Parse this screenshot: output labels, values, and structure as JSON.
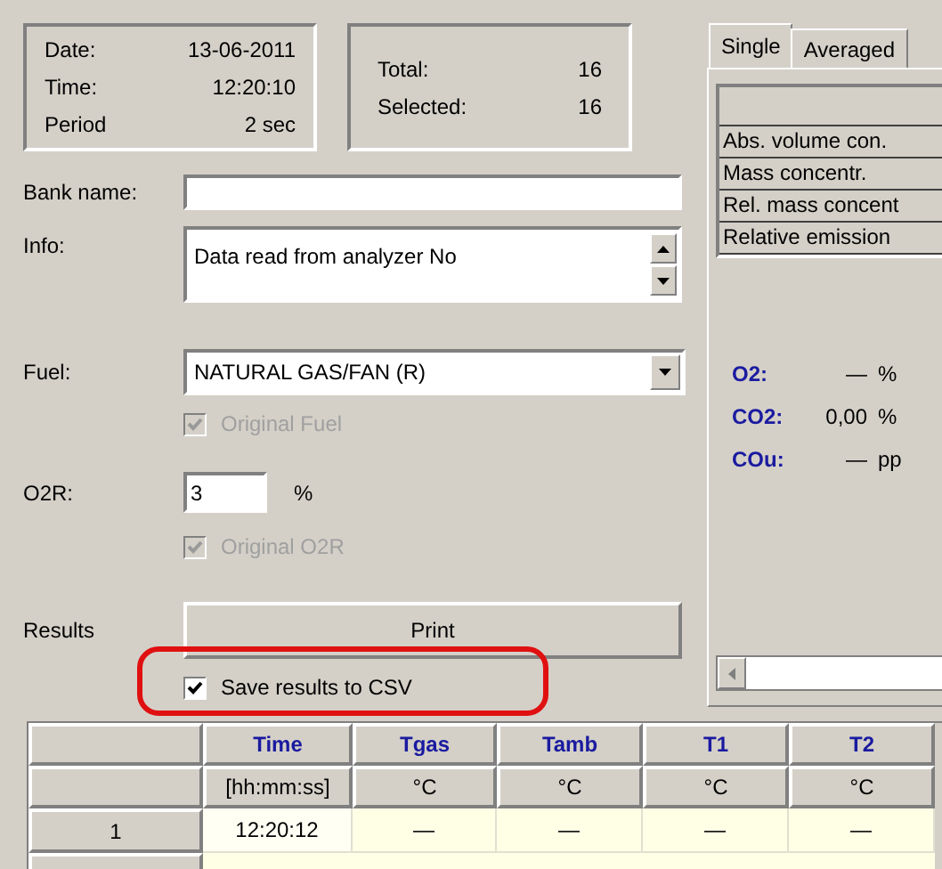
{
  "summary": [
    {
      "label": "Date:",
      "value": "13-06-2011"
    },
    {
      "label": "Time:",
      "value": "12:20:10"
    },
    {
      "label": "Period",
      "value": "2 sec"
    }
  ],
  "counts": [
    {
      "label": "Total:",
      "value": "16"
    },
    {
      "label": "Selected:",
      "value": "16"
    }
  ],
  "form": {
    "bank_name": {
      "label": "Bank name:"
    },
    "info": {
      "label": "Info:",
      "value": "Data read from analyzer No"
    },
    "fuel": {
      "label": "Fuel:",
      "value": "NATURAL GAS/FAN (R)"
    },
    "original_fuel": {
      "label": "Original Fuel",
      "checked": true,
      "disabled": true
    },
    "o2r": {
      "label": "O2R:",
      "value": "3",
      "unit": "%"
    },
    "original_o2r": {
      "label": "Original O2R",
      "checked": true,
      "disabled": true
    },
    "results": {
      "label": "Results",
      "button": "Print"
    },
    "save_csv": {
      "label": "Save results to CSV",
      "checked": true,
      "disabled": false,
      "highlighted": true
    }
  },
  "tabs": [
    {
      "label": "Single",
      "selected": true
    },
    {
      "label": "Averaged",
      "selected": false
    }
  ],
  "concentration_list": [
    "Abs. volume con.",
    "Mass concentr.",
    "Rel. mass concent",
    "Relative emission"
  ],
  "readings": [
    {
      "name": "O2:",
      "value": "—",
      "unit": "%"
    },
    {
      "name": "CO2:",
      "value": "0,00",
      "unit": "%"
    },
    {
      "name": "COu:",
      "value": "—",
      "unit": "pp"
    }
  ],
  "table": {
    "columns": [
      {
        "name": "Time",
        "unit": "[hh:mm:ss]"
      },
      {
        "name": "Tgas",
        "unit": "°C"
      },
      {
        "name": "Tamb",
        "unit": "°C"
      },
      {
        "name": "T1",
        "unit": "°C"
      },
      {
        "name": "T2",
        "unit": "°C"
      }
    ],
    "rows": [
      {
        "index": "1",
        "cells": [
          "12:20:12",
          "—",
          "—",
          "—",
          "—"
        ]
      }
    ]
  }
}
